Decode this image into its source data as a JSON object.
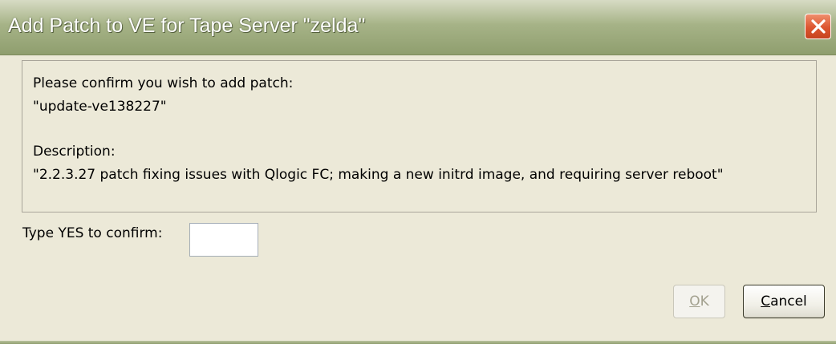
{
  "window": {
    "title": "Add Patch to VE for Tape Server \"zelda\"",
    "close_icon": "close-x-icon"
  },
  "message": {
    "confirm_prompt": "Please confirm you wish to add patch:",
    "patch_name": "\"update-ve138227\"",
    "description_label": "Description:",
    "description_text": "\"2.2.3.27 patch fixing issues with Qlogic FC; making a new initrd image, and requiring server reboot\""
  },
  "confirm": {
    "label": "Type YES to confirm:",
    "value": ""
  },
  "buttons": {
    "ok": "OK",
    "cancel": "Cancel"
  },
  "colors": {
    "titlebar": "#a6b387",
    "dialog_bg": "#ece9d8",
    "close_button": "#dd5530"
  }
}
